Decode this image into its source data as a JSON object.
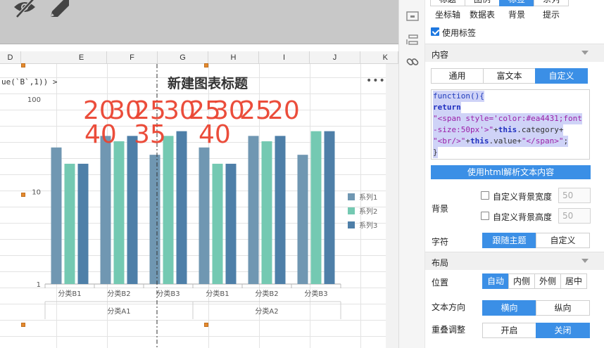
{
  "toolbar": {
    "icons": [
      "eye-off-icon",
      "pencil-icon"
    ]
  },
  "sheet": {
    "columns": [
      "D",
      "E",
      "F",
      "G",
      "H",
      "I",
      "J",
      "K"
    ],
    "formula_fragment": "ue(`B`,1)) >"
  },
  "chart": {
    "title": "新建图表标题",
    "more": "•••",
    "overlay_labels": [
      "20",
      "30",
      "25",
      "30",
      "25",
      "30",
      "25",
      "20",
      "40",
      "35",
      "40"
    ],
    "overlay_color": "#ea4431"
  },
  "chart_data": {
    "type": "bar",
    "title": "新建图表标题",
    "y_scale": "log",
    "ylim": [
      1,
      100
    ],
    "y_ticks": [
      "100",
      "10",
      "1"
    ],
    "categories": [
      "分类B1",
      "分类B2",
      "分类B3",
      "分类B1",
      "分类B2",
      "分类B3"
    ],
    "groups": [
      {
        "label": "分类A1",
        "span": 3
      },
      {
        "label": "分类A2",
        "span": 3
      }
    ],
    "series": [
      {
        "name": "系列1",
        "color": "#7097b2",
        "values": [
          30,
          40,
          25,
          30,
          40,
          25
        ]
      },
      {
        "name": "系列2",
        "color": "#74c9b2",
        "values": [
          20,
          35,
          40,
          20,
          35,
          45
        ]
      },
      {
        "name": "系列3",
        "color": "#4e7fa8",
        "values": [
          20,
          40,
          45,
          20,
          40,
          45
        ]
      }
    ],
    "legend": "right"
  },
  "rail": {
    "icons": [
      "panel-layout-icon",
      "component-stack-icon",
      "link-icon"
    ]
  },
  "panel": {
    "tabs_row1": [
      "标题",
      "图例",
      "标签",
      "系列"
    ],
    "tabs_row1_active": 2,
    "tabs_row2": [
      "坐标轴",
      "数据表",
      "背景",
      "提示"
    ],
    "use_label": "使用标签",
    "content_section": "内容",
    "content_modes": [
      "通用",
      "富文本",
      "自定义"
    ],
    "content_mode_active": 2,
    "code": {
      "l1": "function(){",
      "l2": "return",
      "l3a": "\"<span style='color:#ea4431;font",
      "l3b": "-size:50px'>\"",
      "l3c": "+",
      "l3d": "this",
      "l3e": ".category+",
      "l4a": "\"<br/>\"",
      "l4b": "+",
      "l4c": "this",
      "l4d": ".value+",
      "l4e": "\"</span>\"",
      "l4f": ";",
      "l5": "}"
    },
    "html_button": "使用html解析文本内容",
    "background_label": "背景",
    "custom_bg_width": "自定义背景宽度",
    "custom_bg_height": "自定义背景高度",
    "bg_width_value": "50",
    "bg_height_value": "50",
    "font_label": "字符",
    "font_options": [
      "跟随主题",
      "自定义"
    ],
    "layout_section": "布局",
    "position_label": "位置",
    "position_options": [
      "自动",
      "内侧",
      "外侧",
      "居中"
    ],
    "text_direction_label": "文本方向",
    "direction_options": [
      "横向",
      "纵向"
    ],
    "overlap_label": "重叠调整",
    "overlap_options": [
      "开启",
      "关闭"
    ]
  }
}
